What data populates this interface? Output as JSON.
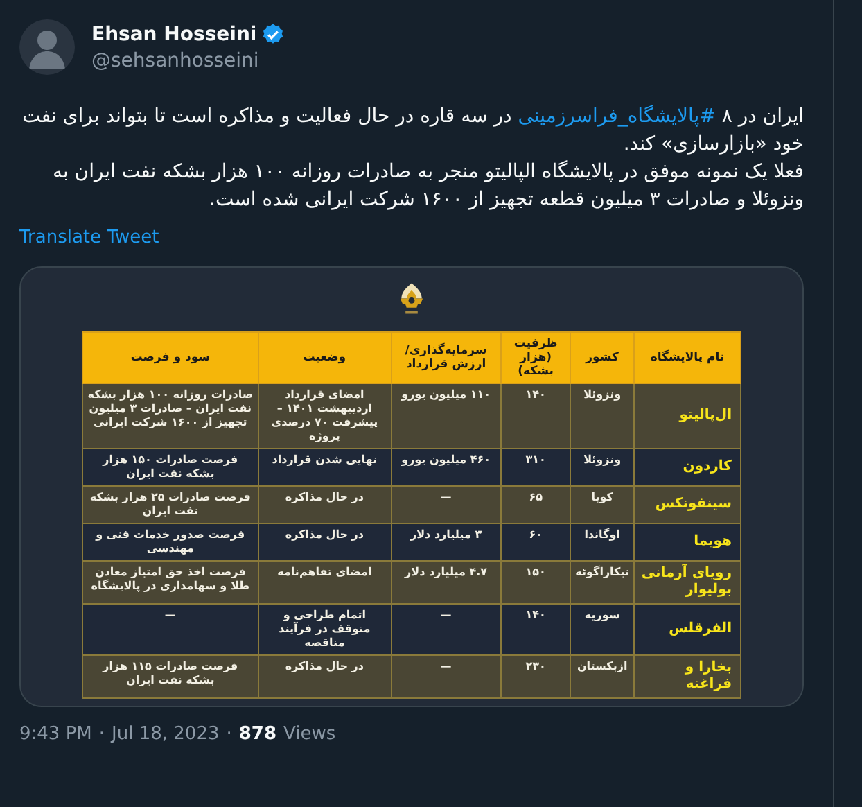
{
  "author": {
    "name": "Ehsan Hosseini",
    "verified": true,
    "handle": "@sehsanhosseini"
  },
  "tweet": {
    "paragraphs": [
      [
        {
          "kind": "text",
          "text": "ایران در ۸ "
        },
        {
          "kind": "hashtag",
          "text": "#پالایشگاه_فراسرزمینی"
        },
        {
          "kind": "text",
          "text": " در سه قاره در حال فعالیت و مذاکره است تا بتواند برای نفت خود «بازارسازی» کند."
        }
      ],
      [
        {
          "kind": "text",
          "text": "فعلا یک نمونه موفق در پالایشگاه الپالیتو منجر به صادرات روزانه ۱۰۰ هزار بشکه نفت ایران به ونزوئلا و صادرات ۳ میلیون قطعه تجهیز از ۱۶۰۰ شرکت ایرانی شده است."
        }
      ]
    ],
    "translate": "Translate Tweet"
  },
  "table": {
    "columns": [
      "نام پالایشگاه",
      "کشور",
      "ظرفیت (هزار بشکه)",
      "سرمایه‌گذاری/ ارزش قرارداد",
      "وضعیت",
      "سود و فرصت"
    ],
    "rows": [
      [
        "ال‌پالیتو",
        "ونزوئلا",
        "۱۴۰",
        "۱۱۰ میلیون یورو",
        "امضای قرارداد اردیبهشت ۱۴۰۱ – پیشرفت ۷۰ درصدی پروژه",
        "صادرات روزانه ۱۰۰ هزار بشکه نفت ایران – صادرات ۳ میلیون تجهیز از ۱۶۰۰ شرکت ایرانی"
      ],
      [
        "کاردون",
        "ونزوئلا",
        "۳۱۰",
        "۴۶۰ میلیون یورو",
        "نهایی شدن قرارداد",
        "فرصت صادرات ۱۵۰ هزار بشکه نفت ایران"
      ],
      [
        "سینفونکس",
        "کوبا",
        "۶۵",
        "—",
        "در حال مذاکره",
        "فرصت صادرات ۲۵ هزار بشکه نفت ایران"
      ],
      [
        "هویما",
        "اوگاندا",
        "۶۰",
        "۳ میلیارد دلار",
        "در حال مذاکره",
        "فرصت صدور خدمات فنی و مهندسی"
      ],
      [
        "رویای آرمانی بولیوار",
        "نیکاراگوئه",
        "۱۵۰",
        "۴.۷ میلیارد دلار",
        "امضای تفاهم‌نامه",
        "فرصت اخذ حق امتیاز معادن طلا و سهامداری در پالایشگاه"
      ],
      [
        "الفرقلس",
        "سوریه",
        "۱۴۰",
        "—",
        "اتمام طراحی و متوقف در فرآیند مناقصه",
        "—"
      ],
      [
        "بخارا و فراغنه",
        "ازبکستان",
        "۲۳۰",
        "—",
        "در حال مذاکره",
        "فرصت صادرات ۱۱۵ هزار بشکه نفت ایران"
      ]
    ]
  },
  "footer": {
    "time": "9:43 PM",
    "separator": "·",
    "date": "Jul 18, 2023",
    "views_count": "878",
    "views_label": "Views"
  }
}
